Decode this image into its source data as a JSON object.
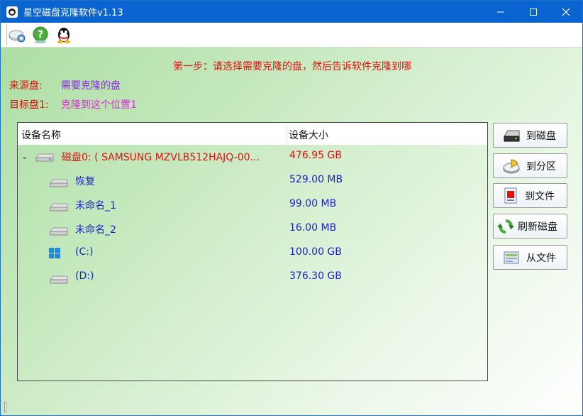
{
  "window": {
    "title": "星空磁盘克隆软件v1.13"
  },
  "toolbar": {
    "buttons": [
      {
        "name": "settings-disk-icon"
      },
      {
        "name": "help-icon"
      },
      {
        "name": "qq-icon"
      }
    ]
  },
  "main": {
    "step_text": "第一步：请选择需要克隆的盘，然后告诉软件克隆到哪",
    "source_label": "来源盘:",
    "source_value": "需要克隆的盘",
    "target_label": "目标盘1:",
    "target_value": "克隆到这个位置1"
  },
  "tree": {
    "headers": {
      "name": "设备名称",
      "size": "设备大小"
    },
    "disk": {
      "name": "磁盘0: ( SAMSUNG MZVLB512HAJQ-00...",
      "size": "476.95 GB"
    },
    "partitions": [
      {
        "name": "恢复",
        "size": "529.00 MB",
        "icon": "drive-icon"
      },
      {
        "name": "未命名_1",
        "size": "99.00 MB",
        "icon": "drive-icon"
      },
      {
        "name": "未命名_2",
        "size": "16.00 MB",
        "icon": "drive-icon"
      },
      {
        "name": "(C:)",
        "size": "100.00 GB",
        "icon": "windows-icon"
      },
      {
        "name": "(D:)",
        "size": "376.30 GB",
        "icon": "drive-icon"
      }
    ]
  },
  "side_buttons": {
    "to_disk": "到磁盘",
    "to_partition": "到分区",
    "to_file": "到文件",
    "refresh": "刷新磁盘",
    "from_file": "从文件"
  }
}
